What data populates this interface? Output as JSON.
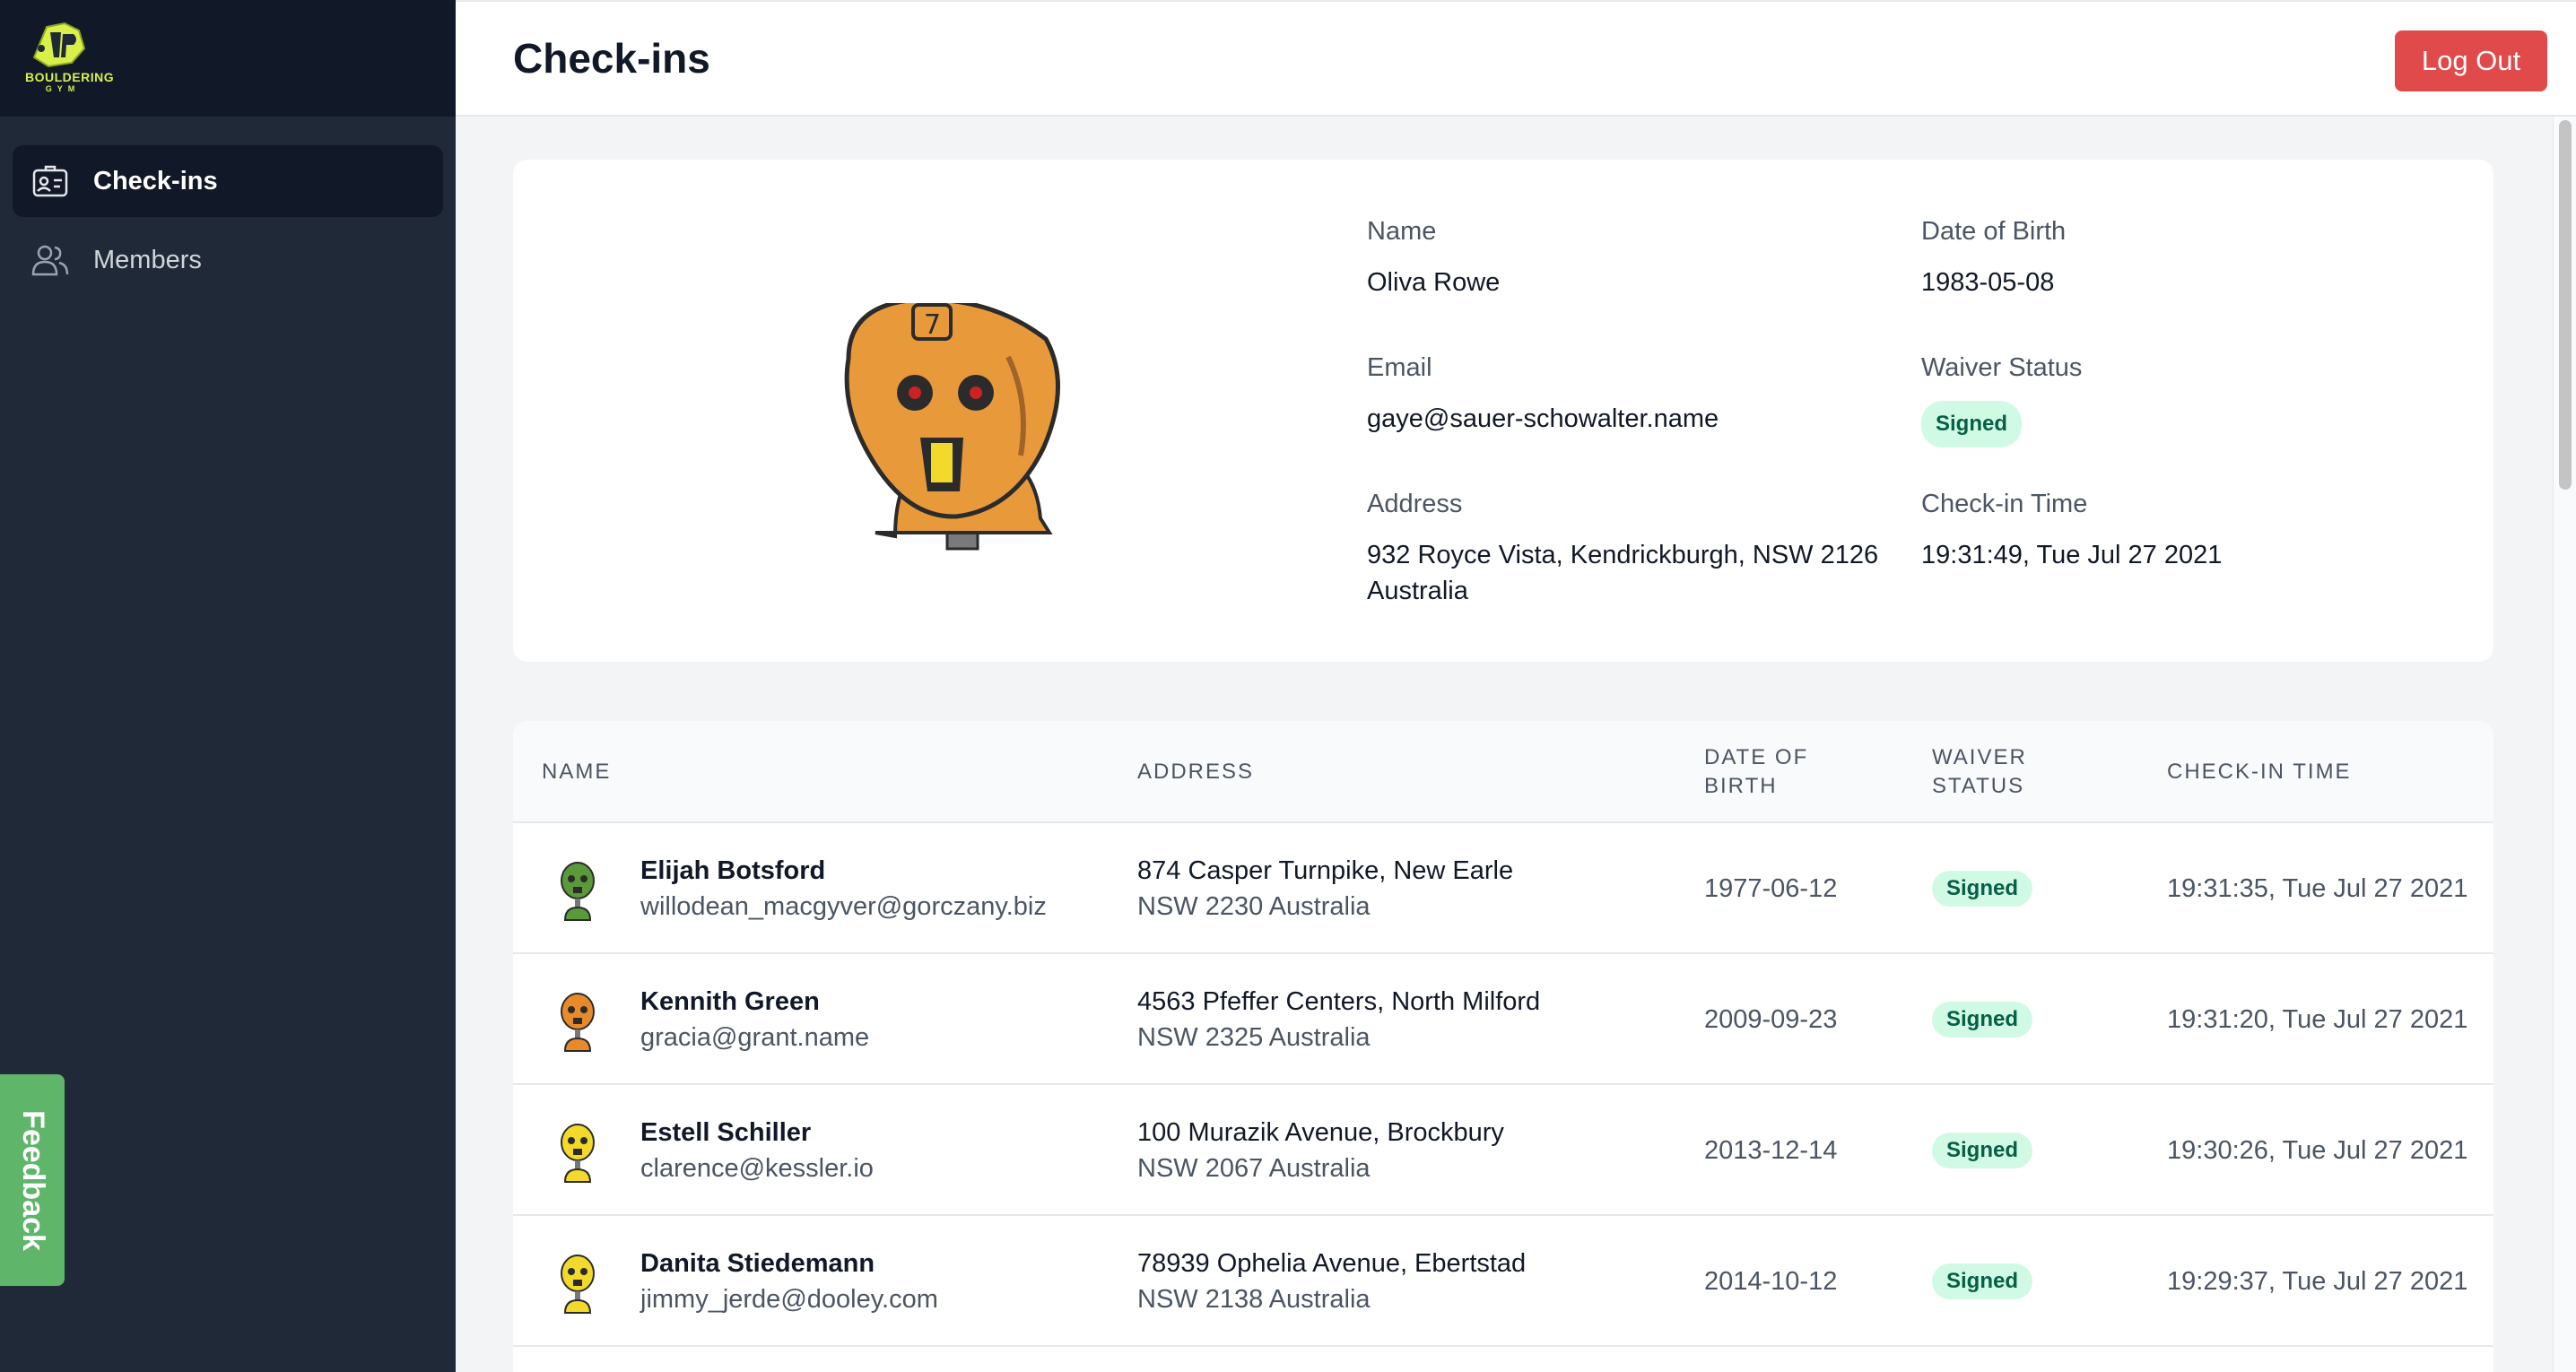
{
  "brand": {
    "logo_line1": "BOULDERING",
    "logo_line2": "GYM"
  },
  "sidebar": {
    "items": [
      {
        "label": "Check-ins",
        "icon": "id-card-icon",
        "active": true
      },
      {
        "label": "Members",
        "icon": "users-icon",
        "active": false
      }
    ]
  },
  "feedback_label": "Feedback",
  "header": {
    "title": "Check-ins",
    "logout_label": "Log Out"
  },
  "detail": {
    "name_label": "Name",
    "name": "Oliva Rowe",
    "dob_label": "Date of Birth",
    "dob": "1983-05-08",
    "email_label": "Email",
    "email": "gaye@sauer-schowalter.name",
    "waiver_label": "Waiver Status",
    "waiver": "Signed",
    "address_label": "Address",
    "address_line1": "932 Royce Vista, Kendrickburgh, NSW 2126",
    "address_line2": "Australia",
    "checkin_label": "Check-in Time",
    "checkin": "19:31:49, Tue Jul 27 2021"
  },
  "table": {
    "headers": {
      "name": "NAME",
      "address": "ADDRESS",
      "dob_line1": "DATE OF",
      "dob_line2": "BIRTH",
      "waiver_line1": "WAIVER",
      "waiver_line2": "STATUS",
      "checkin": "CHECK-IN TIME"
    },
    "rows": [
      {
        "name": "Elijah Botsford",
        "email": "willodean_macgyver@gorczany.biz",
        "addr1": "874 Casper Turnpike, New Earle",
        "addr2": "NSW 2230 Australia",
        "dob": "1977-06-12",
        "waiver": "Signed",
        "checkin": "19:31:35, Tue Jul 27 2021",
        "avatar_color": "#5a9a3a"
      },
      {
        "name": "Kennith Green",
        "email": "gracia@grant.name",
        "addr1": "4563 Pfeffer Centers, North Milford",
        "addr2": "NSW 2325 Australia",
        "dob": "2009-09-23",
        "waiver": "Signed",
        "checkin": "19:31:20, Tue Jul 27 2021",
        "avatar_color": "#e98a2a"
      },
      {
        "name": "Estell Schiller",
        "email": "clarence@kessler.io",
        "addr1": "100 Murazik Avenue, Brockbury",
        "addr2": "NSW 2067 Australia",
        "dob": "2013-12-14",
        "waiver": "Signed",
        "checkin": "19:30:26, Tue Jul 27 2021",
        "avatar_color": "#f2d92a"
      },
      {
        "name": "Danita Stiedemann",
        "email": "jimmy_jerde@dooley.com",
        "addr1": "78939 Ophelia Avenue, Ebertstad",
        "addr2": "NSW 2138 Australia",
        "dob": "2014-10-12",
        "waiver": "Signed",
        "checkin": "19:29:37, Tue Jul 27 2021",
        "avatar_color": "#f2d92a"
      }
    ]
  }
}
